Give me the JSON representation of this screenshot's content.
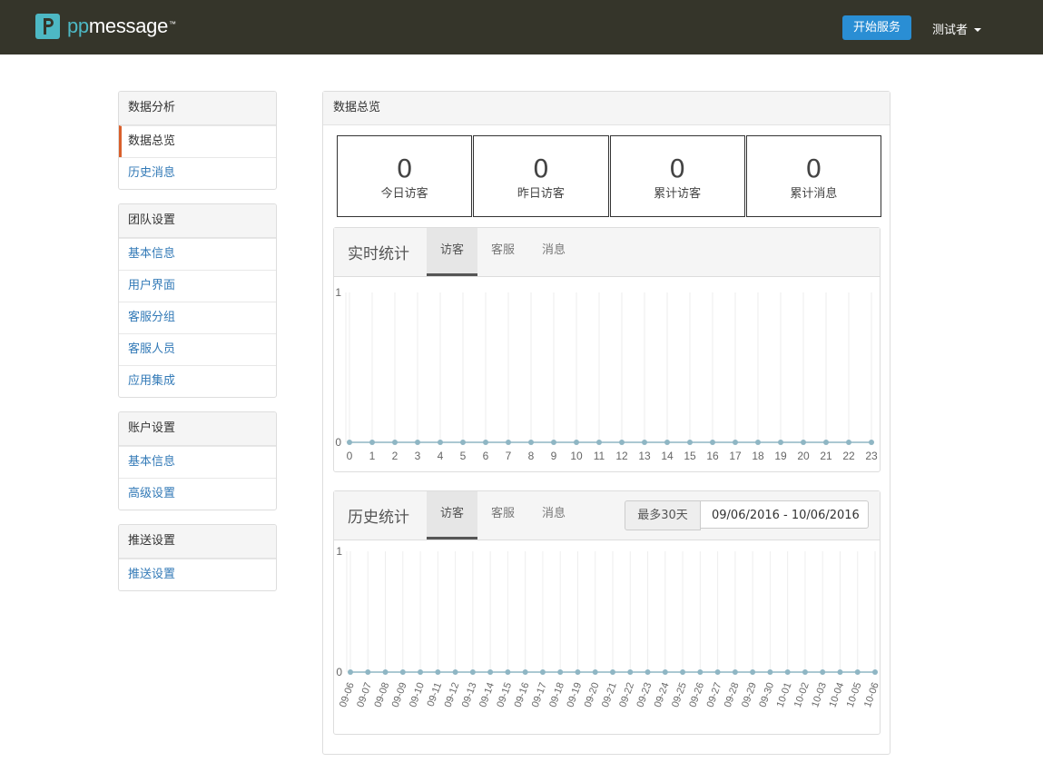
{
  "header": {
    "logo_pp": "pp",
    "logo_message": "message",
    "logo_tm": "™",
    "start_button": "开始服务",
    "user_name": "测试者"
  },
  "sidebar": {
    "groups": [
      {
        "title": "数据分析",
        "items": [
          "数据总览",
          "历史消息"
        ],
        "active": "数据总览"
      },
      {
        "title": "团队设置",
        "items": [
          "基本信息",
          "用户界面",
          "客服分组",
          "客服人员",
          "应用集成"
        ]
      },
      {
        "title": "账户设置",
        "items": [
          "基本信息",
          "高级设置"
        ]
      },
      {
        "title": "推送设置",
        "items": [
          "推送设置"
        ]
      }
    ]
  },
  "overview": {
    "title": "数据总览",
    "stats": [
      {
        "value": "0",
        "label": "今日访客"
      },
      {
        "value": "0",
        "label": "昨日访客"
      },
      {
        "value": "0",
        "label": "累计访客"
      },
      {
        "value": "0",
        "label": "累计消息"
      }
    ]
  },
  "realtime": {
    "title": "实时统计",
    "tabs": [
      "访客",
      "客服",
      "消息"
    ],
    "active_tab": "访客"
  },
  "history": {
    "title": "历史统计",
    "tabs": [
      "访客",
      "客服",
      "消息"
    ],
    "active_tab": "访客",
    "range_label": "最多30天",
    "range_value": "09/06/2016 - 10/06/2016"
  },
  "colors": {
    "accent": "#2a8ed4",
    "active_marker": "#d95f2b",
    "series": "#8fb6c4",
    "topbar": "#35352a",
    "logo": "#4db8c4"
  },
  "chart_data": [
    {
      "type": "line",
      "x": [
        0,
        1,
        2,
        3,
        4,
        5,
        6,
        7,
        8,
        9,
        10,
        11,
        12,
        13,
        14,
        15,
        16,
        17,
        18,
        19,
        20,
        21,
        22,
        23
      ],
      "series": [
        {
          "values": [
            0,
            0,
            0,
            0,
            0,
            0,
            0,
            0,
            0,
            0,
            0,
            0,
            0,
            0,
            0,
            0,
            0,
            0,
            0,
            0,
            0,
            0,
            0,
            0
          ]
        }
      ],
      "ylim": [
        0,
        1
      ],
      "yticks": [
        0,
        1
      ],
      "grid": true
    },
    {
      "type": "line",
      "x": [
        "09-06",
        "09-07",
        "09-08",
        "09-09",
        "09-10",
        "09-11",
        "09-12",
        "09-13",
        "09-14",
        "09-15",
        "09-16",
        "09-17",
        "09-18",
        "09-19",
        "09-20",
        "09-21",
        "09-22",
        "09-23",
        "09-24",
        "09-25",
        "09-26",
        "09-27",
        "09-28",
        "09-29",
        "09-30",
        "10-01",
        "10-02",
        "10-03",
        "10-04",
        "10-05",
        "10-06"
      ],
      "series": [
        {
          "values": [
            0,
            0,
            0,
            0,
            0,
            0,
            0,
            0,
            0,
            0,
            0,
            0,
            0,
            0,
            0,
            0,
            0,
            0,
            0,
            0,
            0,
            0,
            0,
            0,
            0,
            0,
            0,
            0,
            0,
            0,
            0
          ]
        }
      ],
      "ylim": [
        0,
        1
      ],
      "yticks": [
        0,
        1
      ],
      "grid": true
    }
  ]
}
